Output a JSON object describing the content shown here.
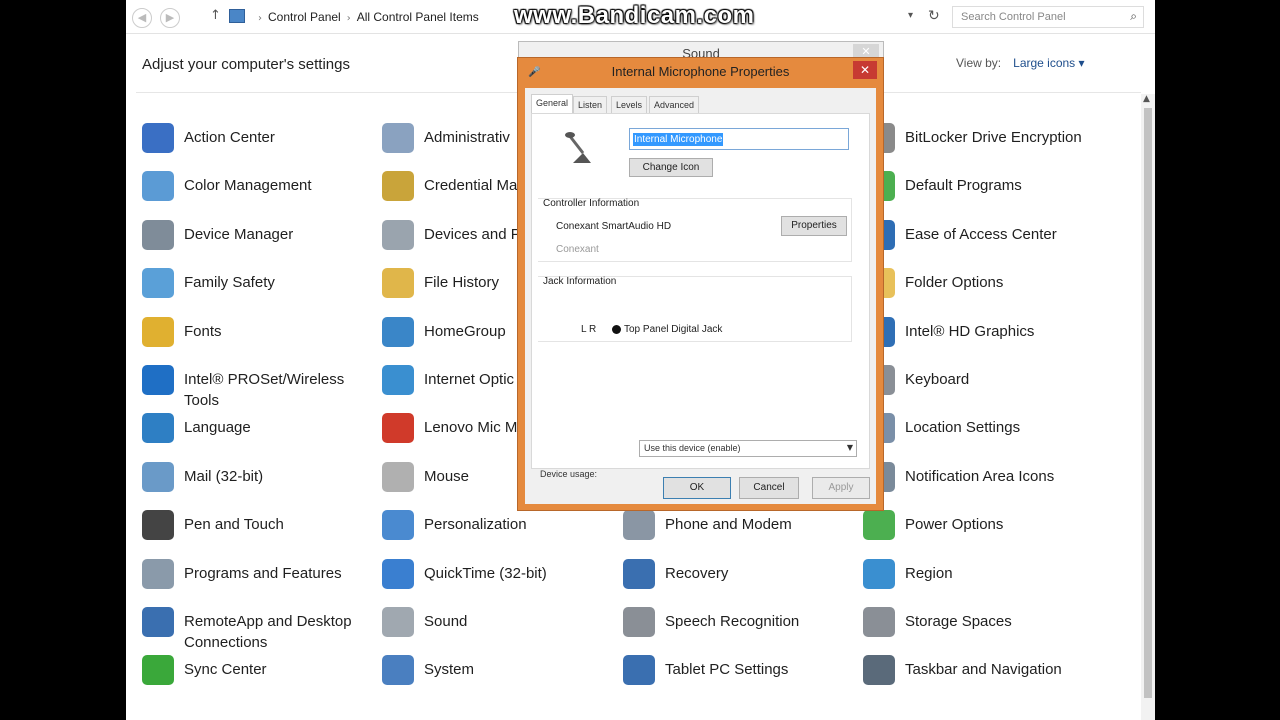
{
  "watermark": "www.Bandicam.com",
  "address_bar": {
    "breadcrumbs": [
      "Control Panel",
      "All Control Panel Items"
    ],
    "search_placeholder": "Search Control Panel"
  },
  "header": {
    "title": "Adjust your computer's settings",
    "view_by_label": "View by:",
    "view_by_value": "Large icons ▾"
  },
  "items": [
    {
      "label": "Action Center",
      "icon": "flag-icon",
      "color": "#3a6fc4"
    },
    {
      "label": "Administrativ",
      "icon": "admin-tools-icon",
      "color": "#8aa2c0"
    },
    {
      "label": "",
      "icon": "",
      "color": ""
    },
    {
      "label": "BitLocker Drive Encryption",
      "icon": "bitlocker-icon",
      "color": "#8a8a8a"
    },
    {
      "label": "Color Management",
      "icon": "color-management-icon",
      "color": "#5b9bd5"
    },
    {
      "label": "Credential Ma",
      "icon": "credential-icon",
      "color": "#c9a43a"
    },
    {
      "label": "",
      "icon": "",
      "color": ""
    },
    {
      "label": "Default Programs",
      "icon": "default-programs-icon",
      "color": "#4caf50"
    },
    {
      "label": "Device Manager",
      "icon": "device-manager-icon",
      "color": "#7f8c99"
    },
    {
      "label": "Devices and P",
      "icon": "printer-icon",
      "color": "#9aa4ae"
    },
    {
      "label": "",
      "icon": "",
      "color": ""
    },
    {
      "label": "Ease of Access Center",
      "icon": "ease-of-access-icon",
      "color": "#2e6db4"
    },
    {
      "label": "Family Safety",
      "icon": "family-safety-icon",
      "color": "#5aa0d8"
    },
    {
      "label": "File History",
      "icon": "file-history-icon",
      "color": "#e0b64a"
    },
    {
      "label": "",
      "icon": "",
      "color": ""
    },
    {
      "label": "Folder Options",
      "icon": "folder-icon",
      "color": "#e8c15a"
    },
    {
      "label": "Fonts",
      "icon": "fonts-icon",
      "color": "#e0b030"
    },
    {
      "label": "HomeGroup",
      "icon": "homegroup-icon",
      "color": "#3a86c8"
    },
    {
      "label": "",
      "icon": "",
      "color": ""
    },
    {
      "label": "Intel® HD Graphics",
      "icon": "intel-graphics-icon",
      "color": "#2f6fb5"
    },
    {
      "label": "Intel® PROSet/Wireless Tools",
      "icon": "wireless-icon",
      "color": "#1f6fc5"
    },
    {
      "label": "Internet Optic",
      "icon": "internet-options-icon",
      "color": "#3a8fd0"
    },
    {
      "label": "",
      "icon": "",
      "color": ""
    },
    {
      "label": "Keyboard",
      "icon": "keyboard-icon",
      "color": "#8a8f96"
    },
    {
      "label": "Language",
      "icon": "language-icon",
      "color": "#2e7fc4"
    },
    {
      "label": "Lenovo   Mic Mute",
      "icon": "mic-mute-icon",
      "color": "#d03a2a"
    },
    {
      "label": "",
      "icon": "",
      "color": ""
    },
    {
      "label": "Location Settings",
      "icon": "location-icon",
      "color": "#7a8fa8"
    },
    {
      "label": "Mail (32-bit)",
      "icon": "mail-icon",
      "color": "#6a9ac8"
    },
    {
      "label": "Mouse",
      "icon": "mouse-icon",
      "color": "#b0b0b0"
    },
    {
      "label": "",
      "icon": "",
      "color": ""
    },
    {
      "label": "Notification Area Icons",
      "icon": "notification-icon",
      "color": "#7a8a9a"
    },
    {
      "label": "Pen and Touch",
      "icon": "pen-icon",
      "color": "#444444"
    },
    {
      "label": "Personalization",
      "icon": "personalization-icon",
      "color": "#4a8ad0"
    },
    {
      "label": "Phone and Modem",
      "icon": "phone-modem-icon",
      "color": "#8a96a4"
    },
    {
      "label": "Power Options",
      "icon": "power-options-icon",
      "color": "#4caf50"
    },
    {
      "label": "Programs and Features",
      "icon": "programs-icon",
      "color": "#8a9aaa"
    },
    {
      "label": "QuickTime (32-bit)",
      "icon": "quicktime-icon",
      "color": "#3a7fd0"
    },
    {
      "label": "Recovery",
      "icon": "recovery-icon",
      "color": "#3a6fb0"
    },
    {
      "label": "Region",
      "icon": "region-icon",
      "color": "#3a8fd0"
    },
    {
      "label": "RemoteApp and Desktop Connections",
      "icon": "remoteapp-icon",
      "color": "#3a6fb0"
    },
    {
      "label": "Sound",
      "icon": "sound-icon",
      "color": "#a0a8b0"
    },
    {
      "label": "Speech Recognition",
      "icon": "speech-icon",
      "color": "#8a8f96"
    },
    {
      "label": "Storage Spaces",
      "icon": "storage-icon",
      "color": "#8a8f96"
    },
    {
      "label": "Sync Center",
      "icon": "sync-icon",
      "color": "#3aa83a"
    },
    {
      "label": "System",
      "icon": "system-icon",
      "color": "#4a7fc0"
    },
    {
      "label": "Tablet PC Settings",
      "icon": "tablet-icon",
      "color": "#3a6fb0"
    },
    {
      "label": "Taskbar and Navigation",
      "icon": "taskbar-icon",
      "color": "#5a6a7a"
    }
  ],
  "sound_dialog": {
    "title": "Sound"
  },
  "properties_dialog": {
    "title": "Internal Microphone Properties",
    "tabs": [
      "General",
      "Listen",
      "Levels",
      "Advanced"
    ],
    "name_value": "Internal Microphone",
    "change_icon_label": "Change Icon",
    "controller_heading": "Controller Information",
    "controller_name": "Conexant SmartAudio HD",
    "controller_vendor": "Conexant",
    "properties_button": "Properties",
    "jack_heading": "Jack Information",
    "jack_channels": "L R",
    "jack_name": "Top Panel Digital Jack",
    "device_usage_label": "Device usage:",
    "device_usage_value": "Use this device (enable)",
    "ok_label": "OK",
    "cancel_label": "Cancel",
    "apply_label": "Apply"
  }
}
